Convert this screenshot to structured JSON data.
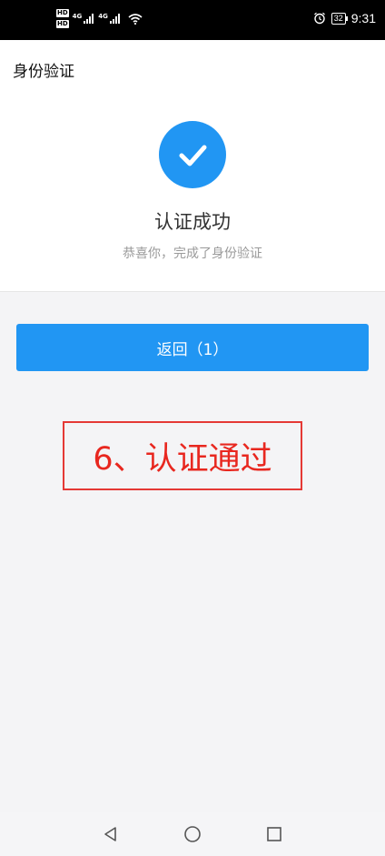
{
  "status_bar": {
    "hd_1": "HD",
    "hd_2": "HD",
    "net_1": "4G",
    "net_2": "4G",
    "battery": "32",
    "time": "9:31"
  },
  "page": {
    "title": "身份验证"
  },
  "result": {
    "title": "认证成功",
    "subtitle": "恭喜你，完成了身份验证"
  },
  "back_button": {
    "label": "返回（1）"
  },
  "annotation": {
    "text": "6、认证通过"
  },
  "colors": {
    "accent": "#2196f3",
    "annotation_red": "#e53935"
  },
  "icons": {
    "success": "checkmark-icon",
    "nav_back": "triangle-back-icon",
    "nav_home": "circle-home-icon",
    "nav_recent": "square-recent-icon"
  }
}
